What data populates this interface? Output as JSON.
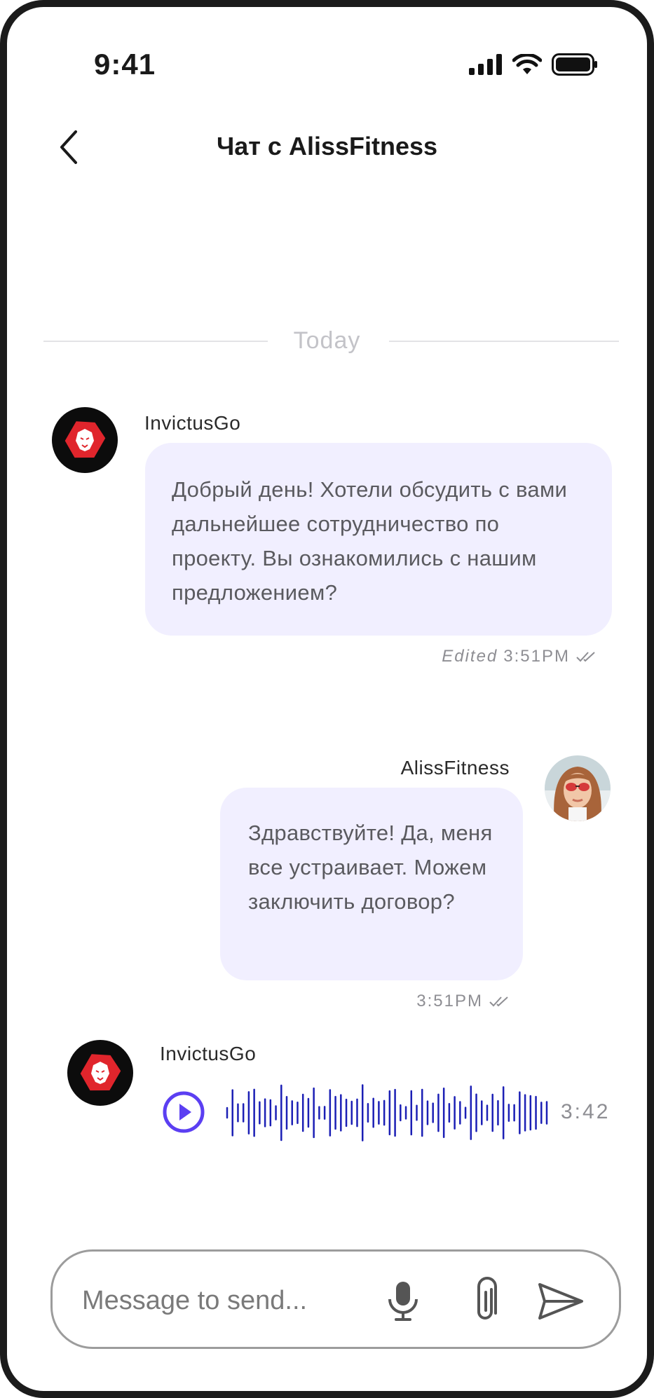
{
  "status_bar": {
    "time": "9:41"
  },
  "header": {
    "title": "Чат с AlissFitness"
  },
  "date_divider": "Today",
  "messages": [
    {
      "sender": "InvictusGo",
      "text": "Добрый день! Хотели обсудить с вами дальнейшее сотрудничество по проекту. Вы ознакомились с нашим предложением?",
      "edited_label": "Edited",
      "time": "3:51PM"
    },
    {
      "sender": "AlissFitness",
      "text": "Здравствуйте! Да, меня все устраивает. Можем заключить договор?",
      "time": "3:51PM"
    },
    {
      "sender": "InvictusGo",
      "voice_duration": "3:42"
    }
  ],
  "composer": {
    "placeholder": "Message to send..."
  },
  "colors": {
    "bubble": "#f1efff",
    "accent": "#5b3ff2",
    "wave": "#1b1fb5",
    "logo_red": "#e0252c"
  },
  "icons": [
    "back-icon",
    "signal-icon",
    "wifi-icon",
    "battery-icon",
    "lion-logo-icon",
    "double-check-icon",
    "play-icon",
    "microphone-icon",
    "paperclip-icon",
    "send-icon"
  ]
}
